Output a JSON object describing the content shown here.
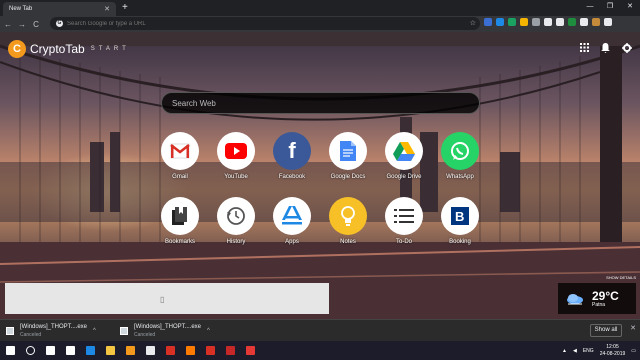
{
  "browser": {
    "tab_title": "New Tab",
    "tab_close": "✕",
    "new_tab": "+",
    "window_controls": [
      "—",
      "❐",
      "✕"
    ],
    "back": "←",
    "forward": "→",
    "reload": "C",
    "omnibox_placeholder": "Search Google or type a URL",
    "star": "☆",
    "extension_colors": [
      "#3b6fd4",
      "#1e88e5",
      "#1aa260",
      "#f4b400",
      "#9aa0a6",
      "#e8eaed",
      "#e8eaed",
      "#1e8e3e",
      "#e8eaed",
      "#c58a3a",
      "#e8eaed"
    ]
  },
  "brand": {
    "logo_letter": "C",
    "name": "CryptoTab",
    "sub": "START"
  },
  "topright": {
    "apps": "⋮⋮",
    "bell": "🔔",
    "settings": "⚙"
  },
  "search": {
    "placeholder": "Search Web"
  },
  "tiles": [
    {
      "label": "Gmail",
      "icon": "gmail-icon",
      "bg": "#ffffff"
    },
    {
      "label": "YouTube",
      "icon": "youtube-icon",
      "bg": "#ffffff"
    },
    {
      "label": "Facebook",
      "icon": "facebook-icon",
      "bg": "#3b5998"
    },
    {
      "label": "Google Docs",
      "icon": "google-docs-icon",
      "bg": "#ffffff"
    },
    {
      "label": "Google Drive",
      "icon": "google-drive-icon",
      "bg": "#ffffff"
    },
    {
      "label": "WhatsApp",
      "icon": "whatsapp-icon",
      "bg": "#25d366"
    },
    {
      "label": "Bookmarks",
      "icon": "bookmarks-icon",
      "bg": "#ffffff"
    },
    {
      "label": "History",
      "icon": "history-icon",
      "bg": "#ffffff"
    },
    {
      "label": "Apps",
      "icon": "apps-icon",
      "bg": "#ffffff"
    },
    {
      "label": "Notes",
      "icon": "notes-icon",
      "bg": "#f6c026"
    },
    {
      "label": "To-Do",
      "icon": "todo-icon",
      "bg": "#ffffff"
    },
    {
      "label": "Booking",
      "icon": "booking-icon",
      "bg": "#ffffff"
    }
  ],
  "show_detail": "SHOW DETAILS",
  "weather": {
    "temp": "29°C",
    "city": "Patna"
  },
  "downloads": [
    {
      "name": "[Windows]_THOPT....exe",
      "status": "Canceled"
    },
    {
      "name": "[Windows]_THOPT....exe",
      "status": "Canceled"
    }
  ],
  "shelf": {
    "show_all": "Show all",
    "close": "✕"
  },
  "taskbar": {
    "icon_colors": [
      "#ffffff",
      "#ffffff",
      "#ffffff",
      "#ffffff",
      "#1e88e5",
      "#f4c542",
      "#f39a1e",
      "#e8eaed",
      "#d93025",
      "#ff7a00",
      "#d93025",
      "#c62828",
      "#e53935"
    ],
    "tray_lang": "ENG",
    "time": "12:05",
    "date": "24-08-2019"
  }
}
